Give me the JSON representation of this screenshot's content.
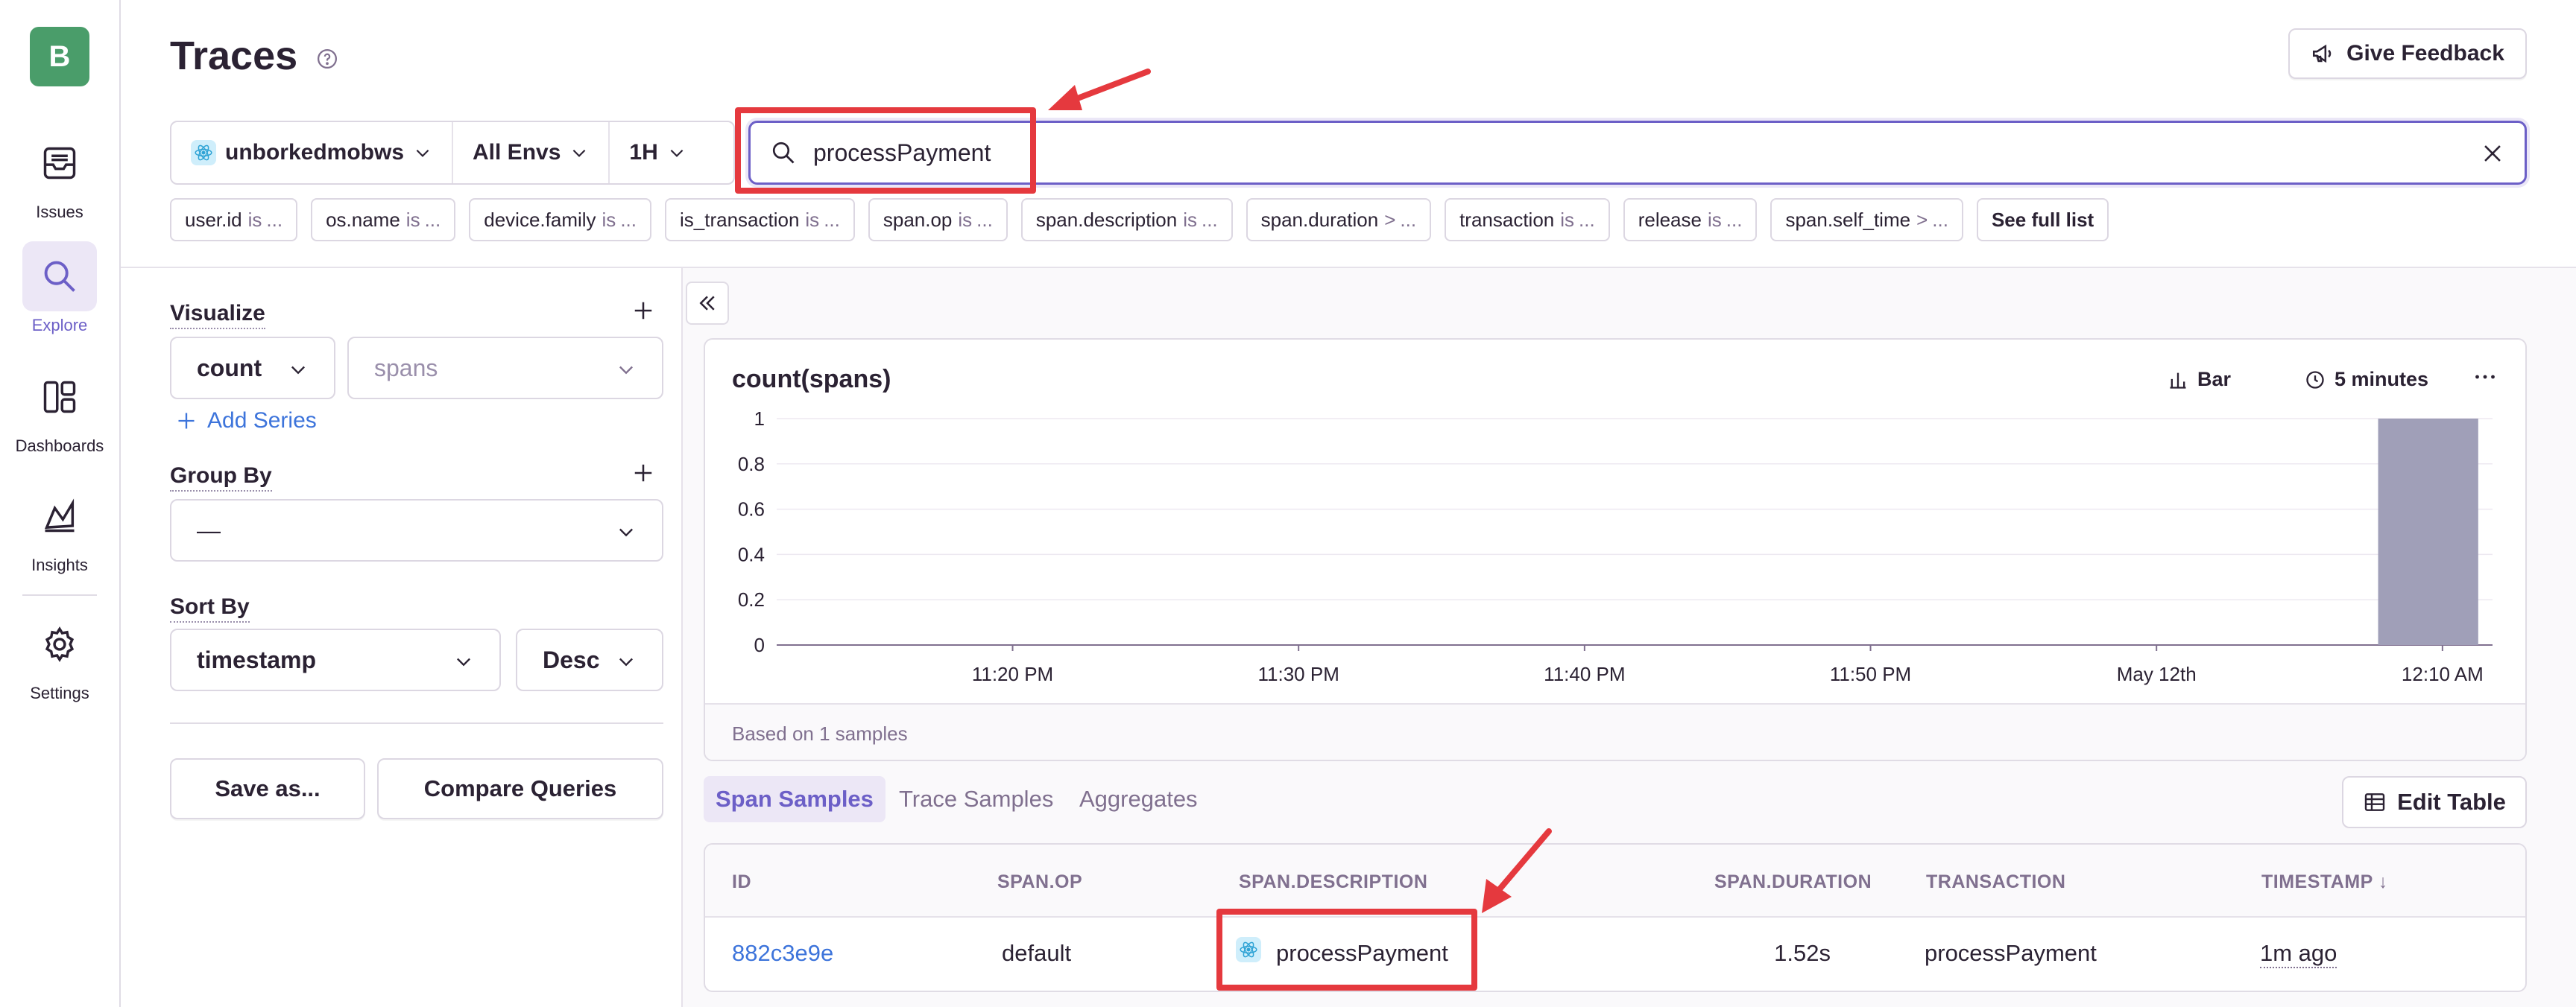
{
  "nav": {
    "org_initial": "B",
    "items": [
      {
        "label": "Issues",
        "icon": "issues-icon"
      },
      {
        "label": "Explore",
        "icon": "search-icon",
        "active": true
      },
      {
        "label": "Dashboards",
        "icon": "dashboards-icon"
      },
      {
        "label": "Insights",
        "icon": "insights-icon"
      },
      {
        "label": "Settings",
        "icon": "gear-icon"
      }
    ]
  },
  "header": {
    "title": "Traces",
    "feedback_label": "Give Feedback"
  },
  "filters": {
    "project": "unborkedmobws",
    "environment": "All Envs",
    "period": "1H"
  },
  "search": {
    "query": "processPayment"
  },
  "chips": [
    {
      "key": "user.id",
      "op": "is",
      "val": "..."
    },
    {
      "key": "os.name",
      "op": "is",
      "val": "..."
    },
    {
      "key": "device.family",
      "op": "is",
      "val": "..."
    },
    {
      "key": "is_transaction",
      "op": "is",
      "val": "..."
    },
    {
      "key": "span.op",
      "op": "is",
      "val": "..."
    },
    {
      "key": "span.description",
      "op": "is",
      "val": "..."
    },
    {
      "key": "span.duration",
      "op": ">",
      "val": "..."
    },
    {
      "key": "transaction",
      "op": "is",
      "val": "..."
    },
    {
      "key": "release",
      "op": "is",
      "val": "..."
    },
    {
      "key": "span.self_time",
      "op": ">",
      "val": "..."
    }
  ],
  "chips_more": "See full list",
  "panel": {
    "visualize_title": "Visualize",
    "function": "count",
    "argument": "spans",
    "add_series": "Add Series",
    "group_by_title": "Group By",
    "group_by_value": "—",
    "sort_by_title": "Sort By",
    "sort_field": "timestamp",
    "sort_order": "Desc",
    "save_as": "Save as...",
    "compare": "Compare Queries"
  },
  "chart_data": {
    "type": "bar",
    "title": "count(spans)",
    "display_type": "Bar",
    "interval": "5 minutes",
    "x_tick_labels": [
      "11:20 PM",
      "11:30 PM",
      "11:40 PM",
      "11:50 PM",
      "May 12th",
      "12:10 AM"
    ],
    "y_ticks": [
      0,
      0.2,
      0.4,
      0.6,
      0.8,
      1
    ],
    "ylim": [
      0,
      1
    ],
    "bucket_count": 12,
    "values": [
      0,
      0,
      0,
      0,
      0,
      0,
      0,
      0,
      0,
      0,
      0,
      1
    ],
    "bar_color": "#a09fb8",
    "grid": true,
    "footer": "Based on 1 samples"
  },
  "tabs": [
    "Span Samples",
    "Trace Samples",
    "Aggregates"
  ],
  "active_tab": "Span Samples",
  "edit_table_label": "Edit Table",
  "table": {
    "columns": [
      "ID",
      "SPAN.OP",
      "SPAN.DESCRIPTION",
      "SPAN.DURATION",
      "TRANSACTION",
      "TIMESTAMP ↓"
    ],
    "rows": [
      {
        "id": "882c3e9e",
        "op": "default",
        "description": "processPayment",
        "duration": "1.52s",
        "transaction": "processPayment",
        "timestamp": "1m ago"
      }
    ]
  },
  "colors": {
    "accent": "#6c5fc7",
    "link": "#3d74db",
    "annotation": "#e5393e",
    "org_badge": "#4a9d6a"
  }
}
